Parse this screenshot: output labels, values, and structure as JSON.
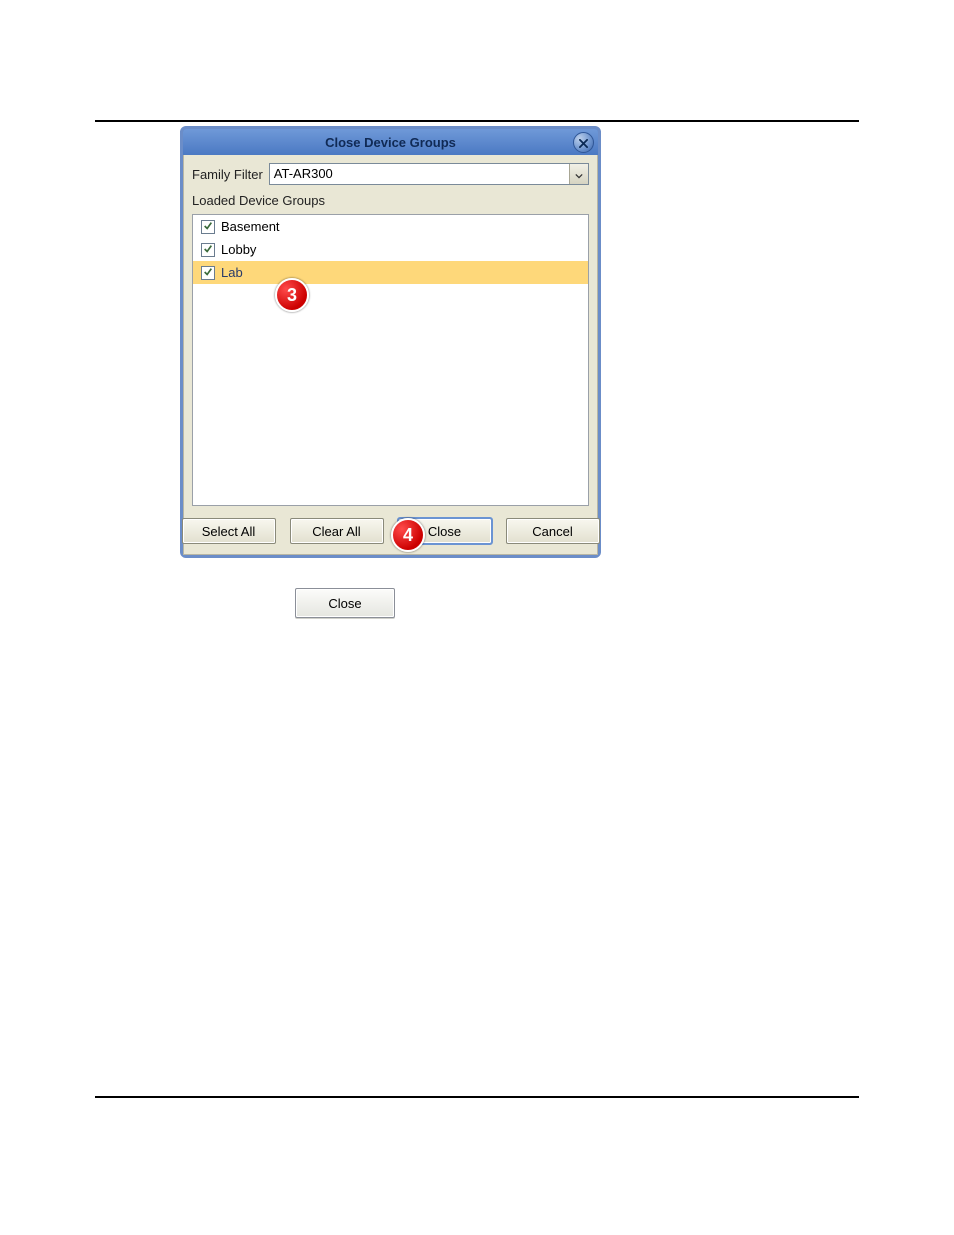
{
  "dialog": {
    "title": "Close Device Groups",
    "filter_label": "Family Filter",
    "filter_value": "AT-AR300",
    "list_label": "Loaded Device Groups",
    "items": [
      {
        "label": "Basement",
        "checked": true,
        "selected": false
      },
      {
        "label": "Lobby",
        "checked": true,
        "selected": false
      },
      {
        "label": "Lab",
        "checked": true,
        "selected": true
      }
    ],
    "buttons": {
      "select_all": "Select All",
      "clear_all": "Clear All",
      "close": "Close",
      "cancel": "Cancel"
    }
  },
  "standalone_close_label": "Close",
  "callouts": {
    "three": "3",
    "four": "4"
  }
}
